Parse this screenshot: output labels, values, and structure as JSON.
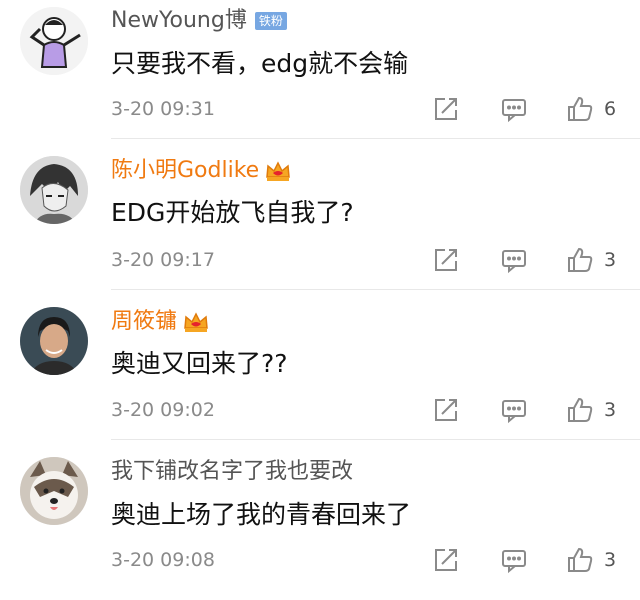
{
  "comments": [
    {
      "user": "NewYoung博",
      "badge": "铁粉",
      "text": "只要我不看，edg就不会输",
      "time": "3-20 09:31",
      "likes": "6",
      "avatar": "cartoon-dab-avatar"
    },
    {
      "user": "陈小明Godlike",
      "badge": "vip-crown",
      "text": "EDG开始放飞自我了?",
      "time": "3-20 09:17",
      "likes": "3",
      "avatar": "anime-character-avatar"
    },
    {
      "user": "周筱镛",
      "badge": "vip-crown",
      "text": "奥迪又回来了??",
      "time": "3-20 09:02",
      "likes": "3",
      "avatar": "person-photo-avatar"
    },
    {
      "user": "我下铺改名字了我也要改",
      "badge": "",
      "text": "奥迪上场了我的青春回来了",
      "time": "3-20 09:08",
      "likes": "3",
      "avatar": "dog-photo-avatar"
    }
  ],
  "colors": {
    "vip_name": "#f07a11",
    "normal_name": "#555555",
    "fan_badge": "#77a7e2",
    "icon_gray": "#8a8a8a"
  },
  "icons": [
    "share-icon",
    "comment-icon",
    "like-icon",
    "crown-icon"
  ]
}
